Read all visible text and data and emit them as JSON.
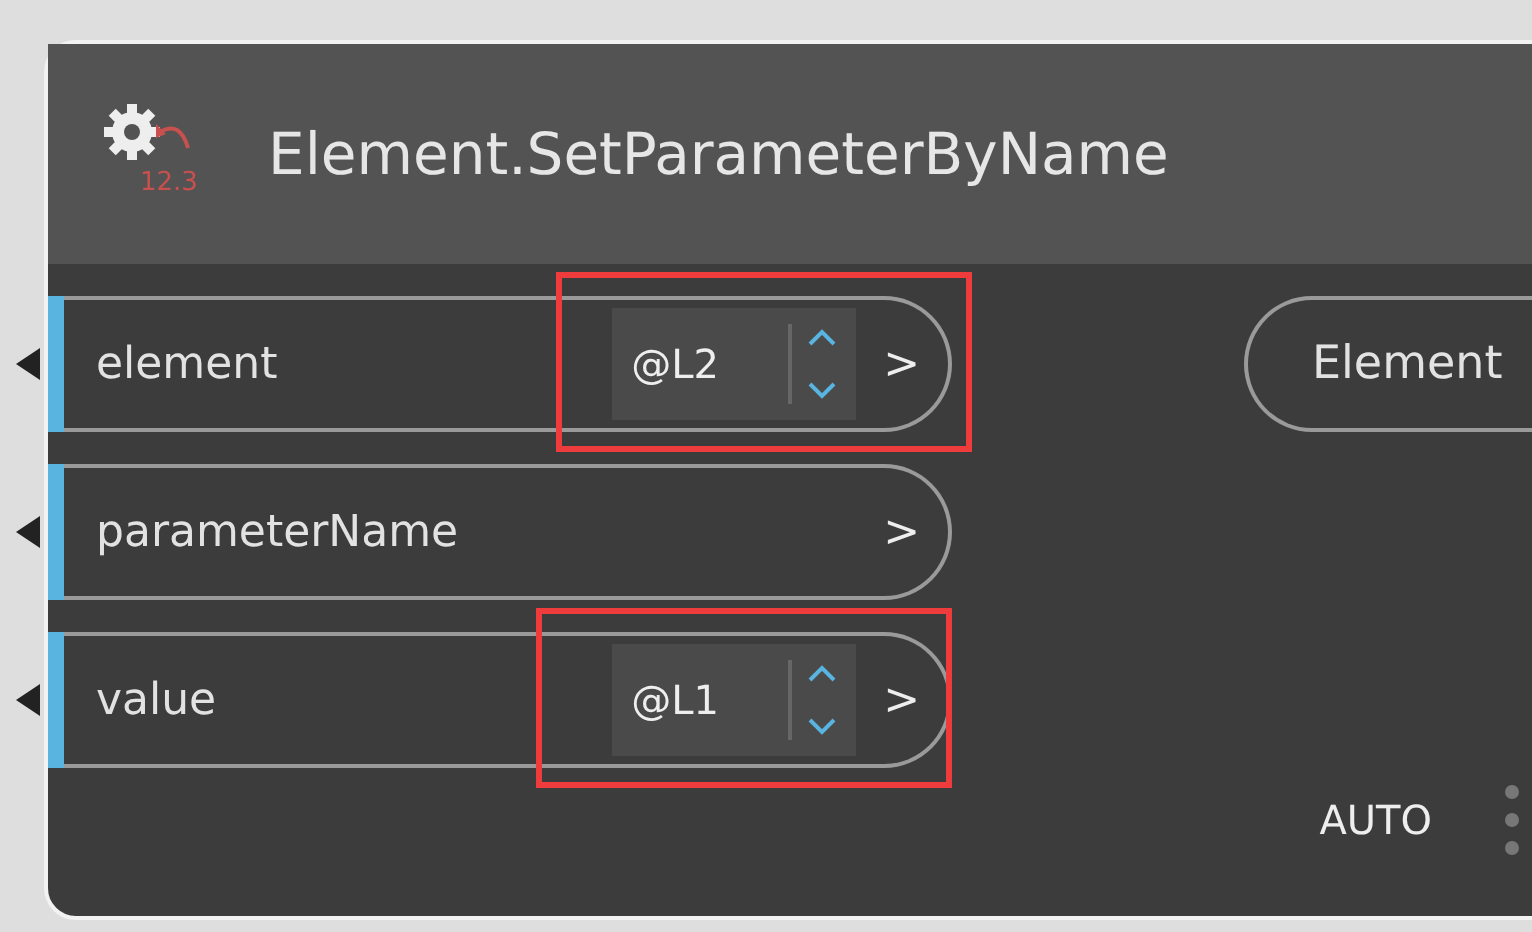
{
  "node": {
    "title": "Element.SetParameterByName",
    "version": "12.3",
    "inputs": [
      {
        "name": "element",
        "kind": "level",
        "level_text": "@L2",
        "chevron": ">",
        "highlighted": true
      },
      {
        "name": "parameterName",
        "kind": "plain",
        "chevron": ">",
        "highlighted": false
      },
      {
        "name": "value",
        "kind": "level",
        "level_text": "@L1",
        "chevron": ">",
        "highlighted": true
      }
    ],
    "outputs": [
      {
        "name": "Element"
      }
    ],
    "run_mode": "AUTO"
  }
}
